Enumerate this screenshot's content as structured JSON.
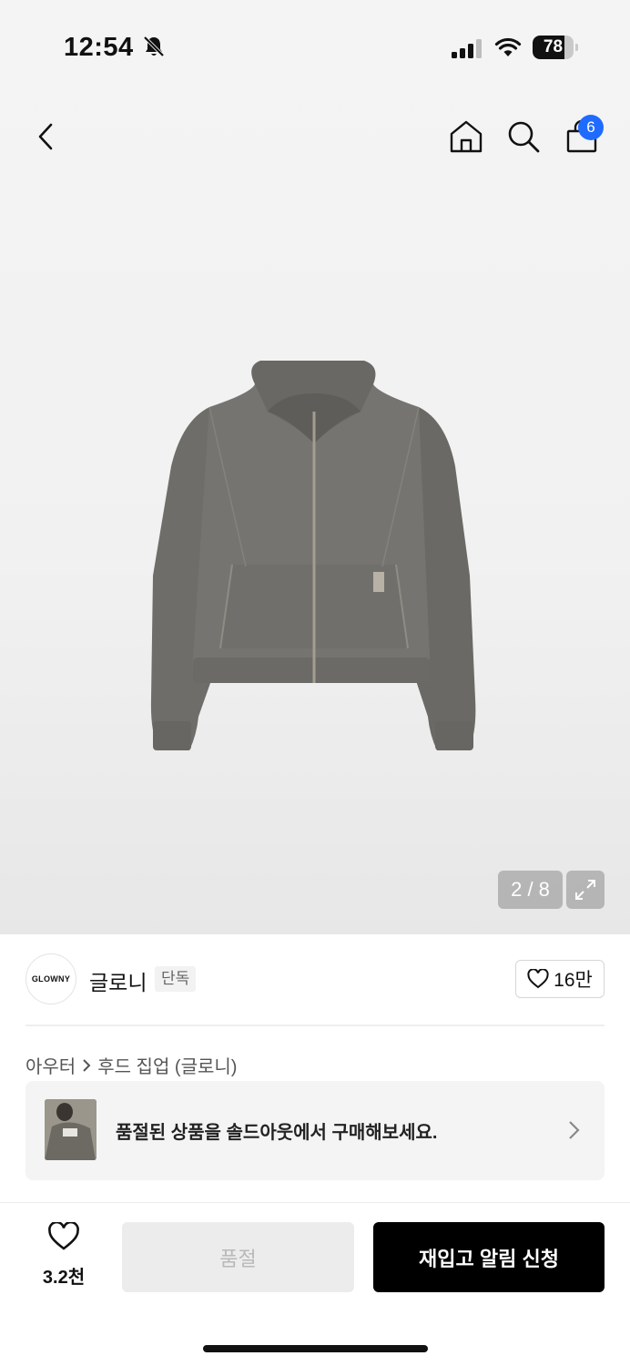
{
  "status_bar": {
    "time": "12:54",
    "battery": "78",
    "battery_level": 0.78
  },
  "nav": {
    "back_icon": "chevron-left-icon",
    "home_icon": "home-icon",
    "search_icon": "search-icon",
    "cart_icon": "shopping-bag-icon",
    "cart_count": "6"
  },
  "gallery": {
    "counter": "2 / 8",
    "expand_icon": "expand-icon"
  },
  "brand": {
    "logo_text": "GLOWNY",
    "name": "글로니",
    "tag": "단독",
    "like_count": "16만"
  },
  "breadcrumb": {
    "items": [
      "아우터",
      "후드 집업 (글로니)"
    ]
  },
  "soldout_banner": {
    "text": "품절된 상품을 솔드아웃에서 구매해보세요."
  },
  "bottom": {
    "wish_count": "3.2천",
    "soldout_label": "품절",
    "restock_label": "재입고 알림 신청"
  },
  "colors": {
    "accent_blue": "#1f6bff",
    "primary_black": "#000000"
  }
}
